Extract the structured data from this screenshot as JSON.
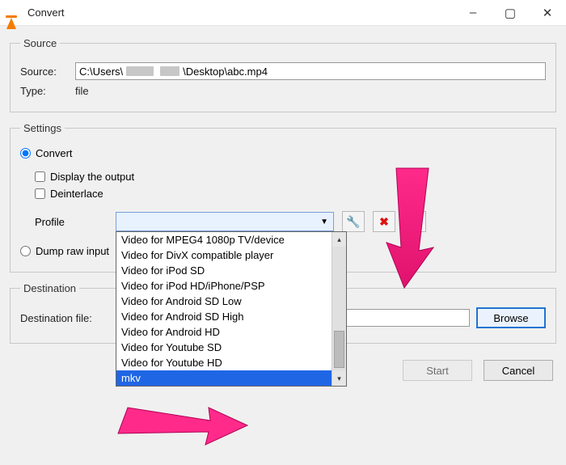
{
  "window": {
    "title": "Convert",
    "minimize": "–",
    "maximize": "▢",
    "close": "✕"
  },
  "source": {
    "legend": "Source",
    "source_label": "Source:",
    "source_value": "C:\\Users\\            \\Desktop\\abc.mp4",
    "type_label": "Type:",
    "type_value": "file"
  },
  "settings": {
    "legend": "Settings",
    "convert_label": "Convert",
    "display_output_label": "Display the output",
    "deinterlace_label": "Deinterlace",
    "profile_label": "Profile",
    "dump_raw_label": "Dump raw input",
    "dropdown_items": [
      "Video for MPEG4 1080p TV/device",
      "Video for DivX compatible player",
      "Video for iPod SD",
      "Video for iPod HD/iPhone/PSP",
      "Video for Android SD Low",
      "Video for Android SD High",
      "Video for Android HD",
      "Video for Youtube SD",
      "Video for Youtube HD",
      "mkv"
    ],
    "selected_item": "mkv",
    "icon_wrench": "🔧",
    "icon_delete": "✖",
    "icon_new": "📄"
  },
  "destination": {
    "legend": "Destination",
    "file_label": "Destination file:",
    "file_value": "",
    "browse_label": "Browse"
  },
  "buttons": {
    "start": "Start",
    "cancel": "Cancel"
  }
}
